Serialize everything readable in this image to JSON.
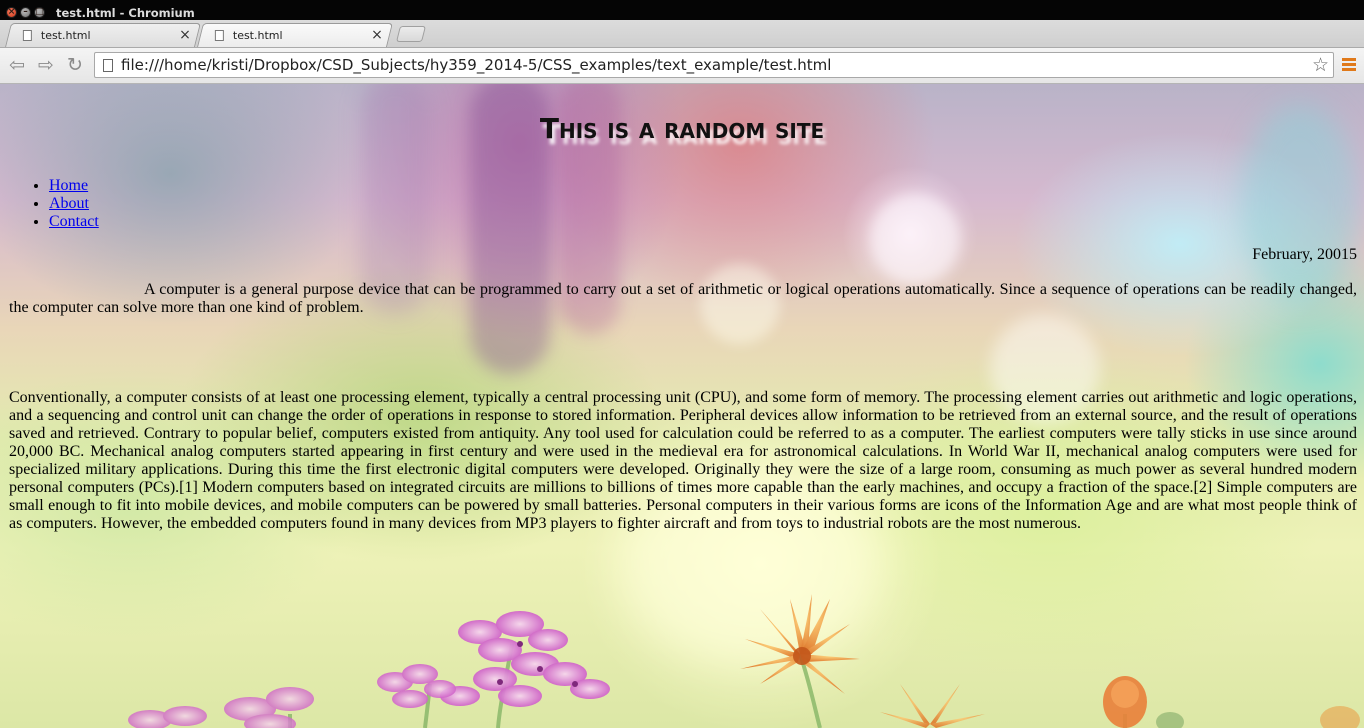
{
  "window": {
    "title": "test.html - Chromium",
    "close_glyph": "×",
    "min_glyph": "–",
    "max_glyph": "□"
  },
  "tabs": [
    {
      "label": "test.html",
      "close_glyph": "×"
    },
    {
      "label": "test.html",
      "close_glyph": "×"
    }
  ],
  "toolbar": {
    "back_glyph": "⇦",
    "forward_glyph": "⇨",
    "reload_glyph": "↻",
    "url": "file:///home/kristi/Dropbox/CSD_Subjects/hy359_2014-5/CSS_examples/text_example/test.html",
    "star_glyph": "☆"
  },
  "page": {
    "title": "This is a random site",
    "nav": [
      {
        "label": "Home"
      },
      {
        "label": "About"
      },
      {
        "label": "Contact"
      }
    ],
    "date": "February, 20015",
    "paragraph1": "A computer is a general purpose device that can be programmed to carry out a set of arithmetic or logical operations automatically. Since a sequence of operations can be readily changed, the computer can solve more than one kind of problem.",
    "paragraph2": "Conventionally, a computer consists of at least one processing element, typically a central processing unit (CPU), and some form of memory. The processing element carries out arithmetic and logic operations, and a sequencing and control unit can change the order of operations in response to stored information. Peripheral devices allow information to be retrieved from an external source, and the result of operations saved and retrieved. Contrary to popular belief, computers existed from antiquity. Any tool used for calculation could be referred to as a computer. The earliest computers were tally sticks in use since around 20,000 BC. Mechanical analog computers started appearing in first century and were used in the medieval era for astronomical calculations. In World War II, mechanical analog computers were used for specialized military applications. During this time the first electronic digital computers were developed. Originally they were the size of a large room, consuming as much power as several hundred modern personal computers (PCs).[1] Modern computers based on integrated circuits are millions to billions of times more capable than the early machines, and occupy a fraction of the space.[2] Simple computers are small enough to fit into mobile devices, and mobile computers can be powered by small batteries. Personal computers in their various forms are icons of the Information Age and are what most people think of as computers. However, the embedded computers found in many devices from MP3 players to fighter aircraft and from toys to industrial robots are the most numerous."
  },
  "colors": {
    "link": "#0000ee",
    "menu_accent": "#e0791a",
    "titlebar": "#050505"
  }
}
